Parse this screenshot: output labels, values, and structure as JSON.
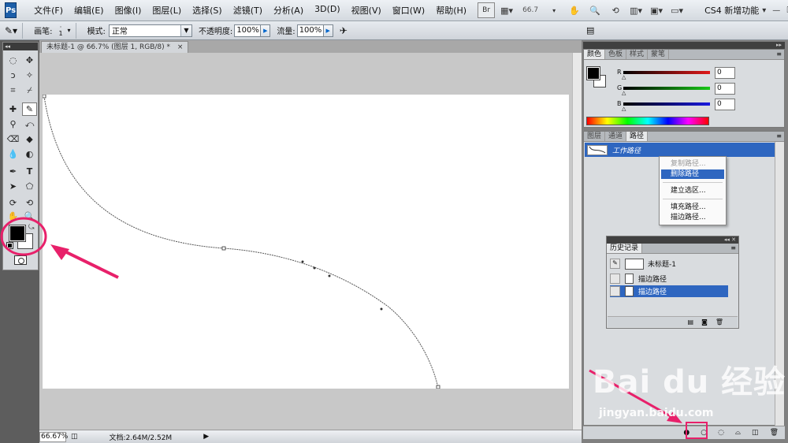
{
  "menubar": {
    "logo": "Ps",
    "items": [
      "文件(F)",
      "编辑(E)",
      "图像(I)",
      "图层(L)",
      "选择(S)",
      "滤镜(T)",
      "分析(A)",
      "3D(D)",
      "视图(V)",
      "窗口(W)",
      "帮助(H)"
    ],
    "zoom": "66.7",
    "workspace": "CS4 新增功能",
    "bridge": "Br"
  },
  "options": {
    "brush_label": "画笔:",
    "brush_size": "1",
    "mode_label": "模式:",
    "mode_value": "正常",
    "opacity_label": "不透明度:",
    "opacity_value": "100%",
    "flow_label": "流量:",
    "flow_value": "100%"
  },
  "document": {
    "tab_title": "未标题-1 @ 66.7% (图层 1, RGB/8) *",
    "close": "×"
  },
  "status": {
    "zoom": "66.67%",
    "doc_info": "文档:2.64M/2.52M"
  },
  "color_panel": {
    "tabs": [
      "颜色",
      "色板",
      "样式",
      "蒙笔"
    ],
    "channels": [
      {
        "label": "R",
        "value": "0",
        "color": "#e01818"
      },
      {
        "label": "G",
        "value": "0",
        "color": "#18c818"
      },
      {
        "label": "B",
        "value": "0",
        "color": "#1818e0"
      }
    ]
  },
  "paths_panel": {
    "tabs": [
      "图层",
      "通道",
      "路径"
    ],
    "active_path": "工作路径"
  },
  "context_menu": {
    "items": [
      "复制路径...",
      "删除路径",
      "建立选区...",
      "填充路径...",
      "描边路径..."
    ]
  },
  "history_panel": {
    "title": "历史记录",
    "snapshot": "未标题-1",
    "rows": [
      "描边路径",
      "描边路径"
    ]
  },
  "watermark": {
    "main": "Bai du 经验",
    "sub": "jingyan.baidu.com"
  },
  "colors": {
    "accent": "#e8206a",
    "selection": "#2e66c0"
  }
}
